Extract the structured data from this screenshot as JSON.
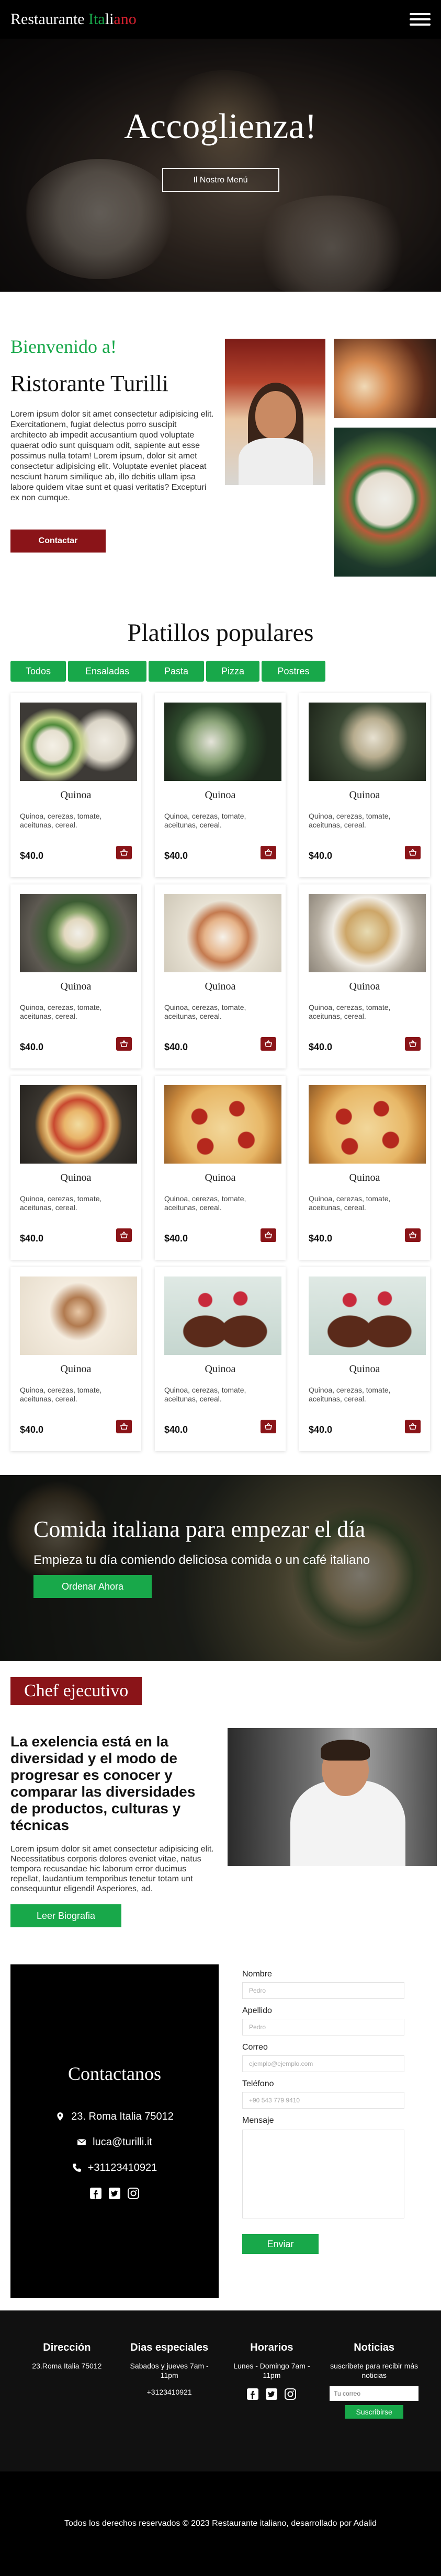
{
  "nav": {
    "brand_prefix": "Restaurante ",
    "brand_it1": "Ita",
    "brand_it2": "li",
    "brand_it3": "ano",
    "menu_icon": "hamburger-icon"
  },
  "hero": {
    "title": "Accoglienza!",
    "button": "Il Nostro Menú"
  },
  "welcome": {
    "eyebrow": "Bienvenido a!",
    "title": "Ristorante Turilli",
    "body": "Lorem ipsum dolor sit amet consectetur adipisicing elit. Exercitationem, fugiat delectus porro suscipit architecto ab impedit accusantium quod voluptate quaerat odio sunt quisquam odit, sapiente aut esse possimus nulla totam! Lorem ipsum, dolor sit amet consectetur adipisicing elit. Voluptate eveniet placeat nesciunt harum similique ab, illo debitis ullam ipsa labore quidem vitae sunt et quasi veritatis? Excepturi ex non cumque.",
    "button": "Contactar"
  },
  "popular": {
    "title": "Platillos populares",
    "tabs": [
      "Todos",
      "Ensaladas",
      "Pasta",
      "Pizza",
      "Postres"
    ],
    "dishes": [
      {
        "title": "Quinoa",
        "desc": "Quinoa, cerezas, tomate, aceitunas, cereal.",
        "price": "$40.0"
      },
      {
        "title": "Quinoa",
        "desc": "Quinoa, cerezas, tomate, aceitunas, cereal.",
        "price": "$40.0"
      },
      {
        "title": "Quinoa",
        "desc": "Quinoa, cerezas, tomate, aceitunas, cereal.",
        "price": "$40.0"
      },
      {
        "title": "Quinoa",
        "desc": "Quinoa, cerezas, tomate, aceitunas, cereal.",
        "price": "$40.0"
      },
      {
        "title": "Quinoa",
        "desc": "Quinoa, cerezas, tomate, aceitunas, cereal.",
        "price": "$40.0"
      },
      {
        "title": "Quinoa",
        "desc": "Quinoa, cerezas, tomate, aceitunas, cereal.",
        "price": "$40.0"
      },
      {
        "title": "Quinoa",
        "desc": "Quinoa, cerezas, tomate, aceitunas, cereal.",
        "price": "$40.0"
      },
      {
        "title": "Quinoa",
        "desc": "Quinoa, cerezas, tomate, aceitunas, cereal.",
        "price": "$40.0"
      },
      {
        "title": "Quinoa",
        "desc": "Quinoa, cerezas, tomate, aceitunas, cereal.",
        "price": "$40.0"
      },
      {
        "title": "Quinoa",
        "desc": "Quinoa, cerezas, tomate, aceitunas, cereal.",
        "price": "$40.0"
      },
      {
        "title": "Quinoa",
        "desc": "Quinoa, cerezas, tomate, aceitunas, cereal.",
        "price": "$40.0"
      },
      {
        "title": "Quinoa",
        "desc": "Quinoa, cerezas, tomate, aceitunas, cereal.",
        "price": "$40.0"
      }
    ],
    "cart_icon": "shopping-basket-icon"
  },
  "banner": {
    "title": "Comida italiana para empezar el día",
    "subtitle": "Empieza tu día comiendo deliciosa comida o un café italiano",
    "button": "Ordenar Ahora"
  },
  "chef": {
    "badge": "Chef ejecutivo",
    "heading": "La exelencia está en la diversidad y el modo de progresar es conocer y comparar las diversidades de productos, culturas y técnicas",
    "body": "Lorem ipsum dolor sit amet consectetur adipisicing elit. Necessitatibus corporis dolores eveniet vitae, natus tempora recusandae hic laborum error ducimus repellat, laudantium temporibus tenetur totam unt consequuntur eligendi! Asperiores, ad.",
    "button": "Leer Biografia"
  },
  "contact": {
    "title": "Contactanos",
    "address": "23. Roma Italia 75012",
    "email": "luca@turilli.it",
    "phone": "+31123410921",
    "form": {
      "name_label": "Nombre",
      "name_placeholder": "Pedro",
      "last_label": "Apellido",
      "last_placeholder": "Pedro",
      "email_label": "Correo",
      "email_placeholder": "ejemplo@ejemplo.com",
      "phone_label": "Teléfono",
      "phone_placeholder": "+90 543 779 9410",
      "message_label": "Mensaje",
      "submit": "Enviar"
    }
  },
  "footer": {
    "address_title": "Dirección",
    "address": "23.Roma Italia 75012",
    "days_title": "Dias especiales",
    "days": "Sabados y jueves 7am - 11pm",
    "days_phone": "+3123410921",
    "hours_title": "Horarios",
    "hours": "Lunes - Domingo 7am - 11pm",
    "news_title": "Noticias",
    "news_text": "suscribete para recibir más noticias",
    "news_placeholder": "Tu correo",
    "news_button": "Suscribirse",
    "copyright": "Todos los derechos reservados © 2023 Restaurante italiano, desarrollado por Adalid"
  },
  "colors": {
    "green": "#18a84a",
    "red": "#8a1418",
    "black": "#000000"
  }
}
